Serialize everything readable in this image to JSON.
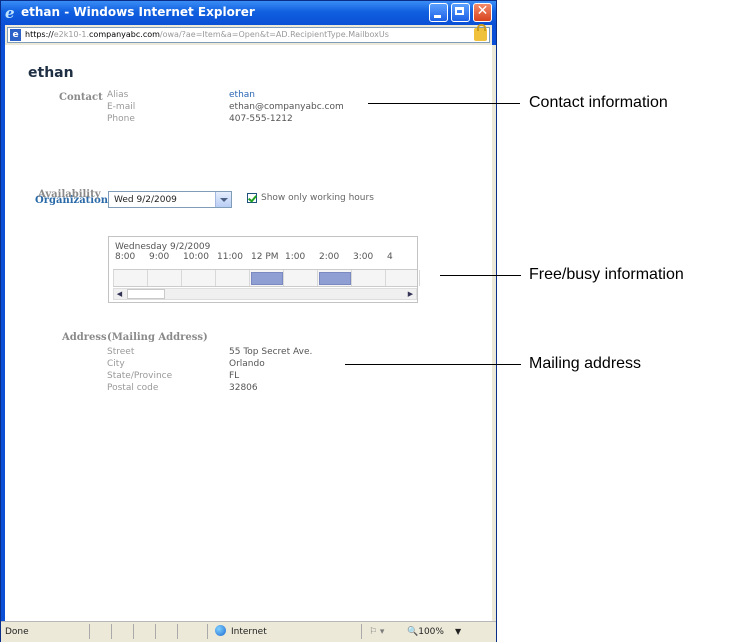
{
  "window": {
    "title": "ethan - Windows Internet Explorer"
  },
  "address": {
    "scheme": "https://",
    "host_dim": "e2k10-1.",
    "host": "companyabc.com",
    "path": "/owa/?ae=Item&a=Open&t=AD.RecipientType.MailboxUs"
  },
  "contact_name": "ethan",
  "contact": {
    "section_label": "Contact",
    "alias_label": "Alias",
    "alias_value": "ethan",
    "email_label": "E-mail",
    "email_value": "ethan@companyabc.com",
    "phone_label": "Phone",
    "phone_value": "407-555-1212"
  },
  "organization": {
    "label": "Organization"
  },
  "availability": {
    "label": "Availability",
    "date_value": "Wed 9/2/2009",
    "checkbox_label": "Show only working hours",
    "checkbox_checked": true
  },
  "freebusy": {
    "date_header": "Wednesday 9/2/2009",
    "times": [
      "8:00",
      "9:00",
      "10:00",
      "11:00",
      "12 PM",
      "1:00",
      "2:00",
      "3:00",
      "4"
    ],
    "busy_blocks": [
      {
        "start": "12 PM",
        "end": "1:00"
      },
      {
        "start": "2:00",
        "end": "3:00"
      }
    ]
  },
  "address_section": {
    "label": "Address",
    "heading": "(Mailing Address)",
    "street_label": "Street",
    "street_value": "55 Top Secret Ave.",
    "city_label": "City",
    "city_value": "Orlando",
    "state_label": "State/Province",
    "state_value": "FL",
    "postal_label": "Postal code",
    "postal_value": "32806"
  },
  "status": {
    "text": "Done",
    "zone": "Internet",
    "zoom": "100%"
  },
  "callouts": {
    "contact": "Contact information",
    "freebusy": "Free/busy information",
    "mailing": "Mailing address"
  },
  "colors": {
    "titlebar": "#0a4fd6",
    "link": "#2c67b4",
    "busy": "#8f9fd3"
  }
}
